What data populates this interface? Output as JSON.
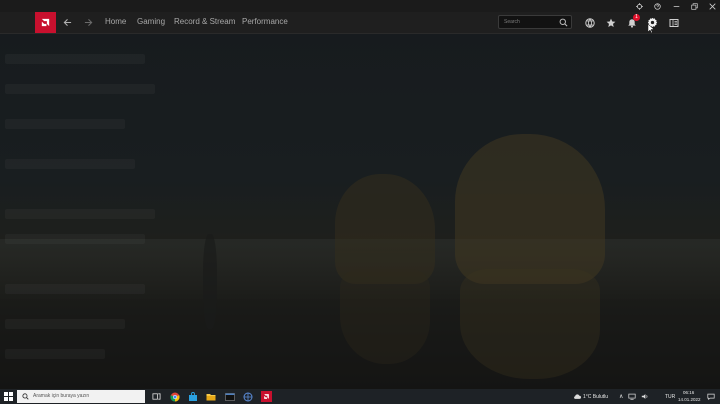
{
  "nav": {
    "links": [
      "Home",
      "Gaming",
      "Record & Stream",
      "Performance"
    ],
    "search_placeholder": "Search",
    "notification_count": "1"
  },
  "taskbar": {
    "search_placeholder": "Aramak için buraya yazın",
    "weather": "1°C  Bulutlu",
    "language": "TUR",
    "time": "06:16",
    "date": "14.01.2022"
  },
  "colors": {
    "accent": "#c8102e",
    "badge": "#e0112b"
  }
}
